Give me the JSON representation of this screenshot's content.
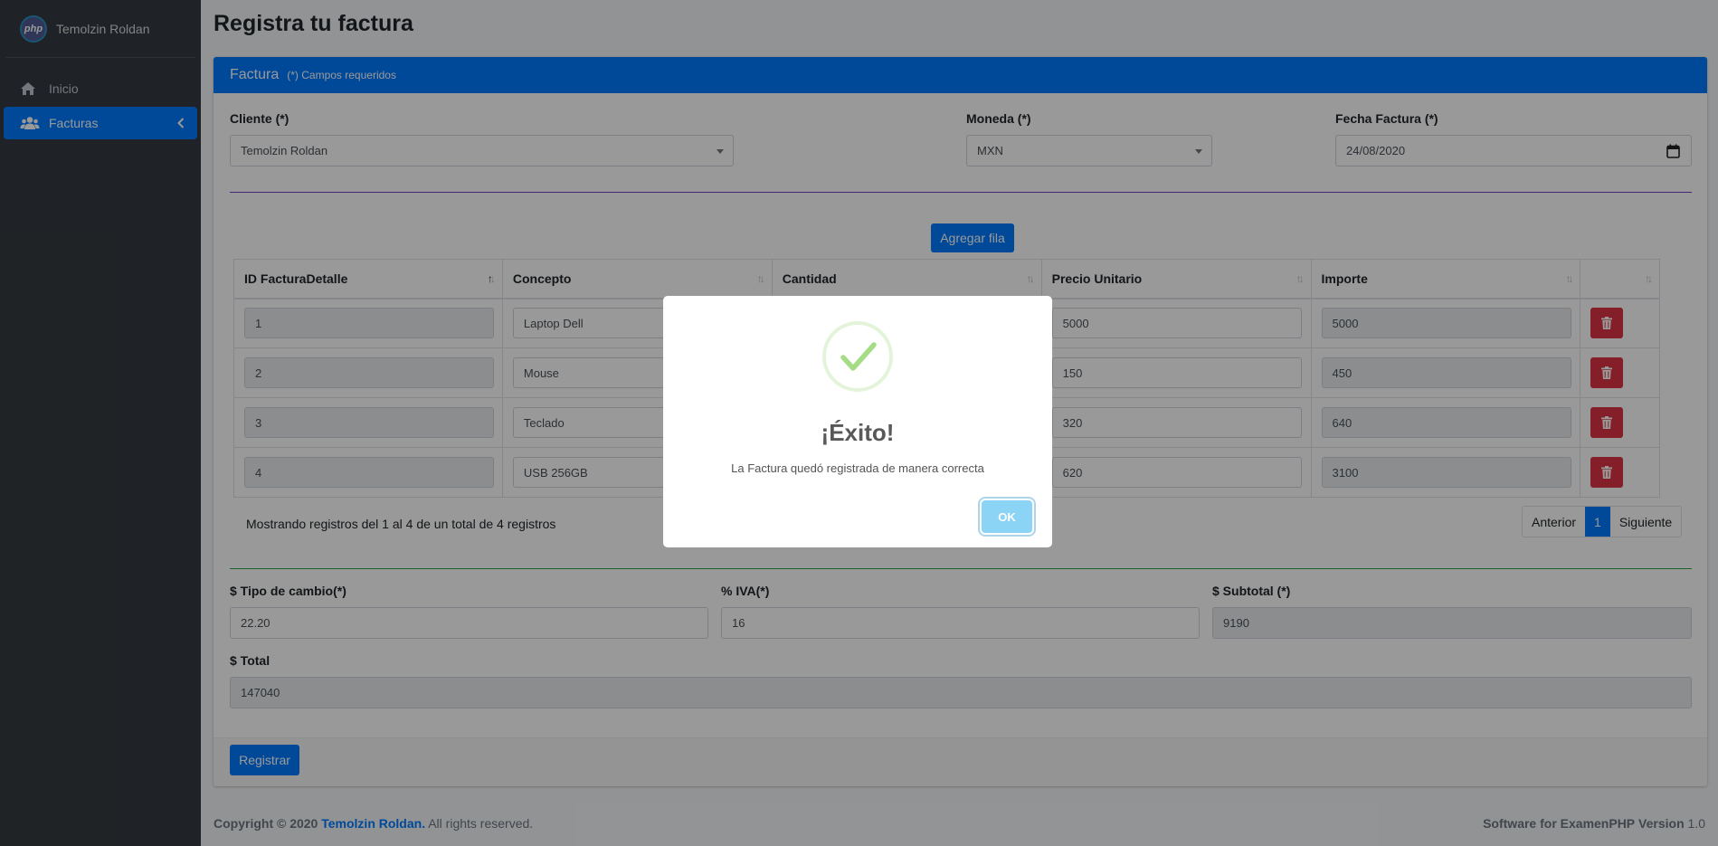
{
  "sidebar": {
    "brand_logo": "php",
    "brand_name": "Temolzin Roldan",
    "items": [
      {
        "label": "Inicio",
        "icon": "home-icon"
      },
      {
        "label": "Facturas",
        "icon": "users-icon"
      }
    ]
  },
  "page": {
    "title": "Registra tu factura"
  },
  "card": {
    "title": "Factura",
    "subtitle": "(*) Campos requeridos"
  },
  "form": {
    "cliente_label": "Cliente (*)",
    "cliente_value": "Temolzin Roldan",
    "moneda_label": "Moneda (*)",
    "moneda_value": "MXN",
    "fecha_label": "Fecha Factura (*)",
    "fecha_value": "24/08/2020",
    "add_row_label": "Agregar fila",
    "tipo_cambio_label": "$ Tipo de cambio(*)",
    "tipo_cambio_value": "22.20",
    "iva_label": "% IVA(*)",
    "iva_value": "16",
    "subtotal_label": "$ Subtotal (*)",
    "subtotal_value": "9190",
    "total_label": "$ Total",
    "total_value": "147040",
    "submit_label": "Registrar"
  },
  "table": {
    "headers": [
      "ID FacturaDetalle",
      "Concepto",
      "Cantidad",
      "Precio Unitario",
      "Importe"
    ],
    "rows": [
      {
        "id": "1",
        "concepto": "Laptop Dell",
        "precio": "5000",
        "importe": "5000"
      },
      {
        "id": "2",
        "concepto": "Mouse",
        "precio": "150",
        "importe": "450"
      },
      {
        "id": "3",
        "concepto": "Teclado",
        "precio": "320",
        "importe": "640"
      },
      {
        "id": "4",
        "concepto": "USB 256GB",
        "precio": "620",
        "importe": "3100"
      }
    ],
    "info": "Mostrando registros del 1 al 4 de un total de 4 registros",
    "pager": {
      "prev": "Anterior",
      "current": "1",
      "next": "Siguiente"
    }
  },
  "footer": {
    "copyright_prefix": "Copyright © 2020",
    "author": "Temolzin Roldan.",
    "rights": "All rights reserved.",
    "version_text": "Software for ExamenPHP",
    "version_label": "Version",
    "version_number": "1.0"
  },
  "modal": {
    "icon": "success-check-icon",
    "title": "¡Éxito!",
    "text": "La Factura quedó registrada de manera correcta",
    "ok_label": "OK"
  },
  "colors": {
    "primary": "#007bff",
    "danger": "#dc3545",
    "sidebar": "#343a40",
    "success_icon": "#a5dc86",
    "modal_ok": "#8cd4f5"
  }
}
